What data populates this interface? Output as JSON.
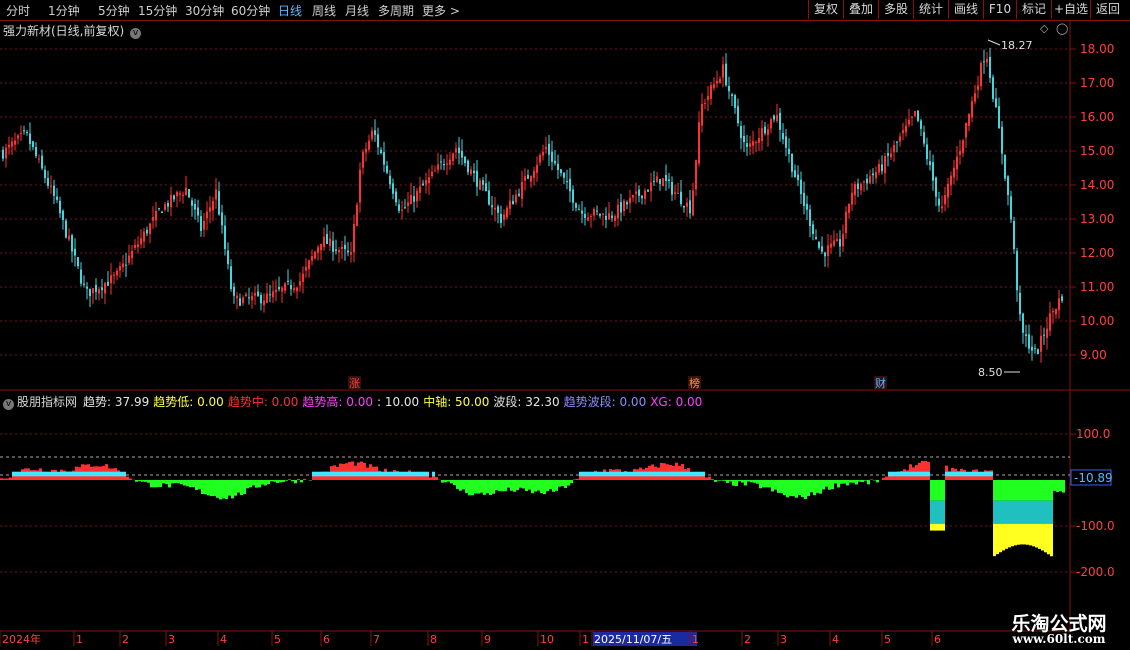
{
  "toolbar": {
    "periods": [
      "分时",
      "1分钟",
      "5分钟",
      "15分钟",
      "30分钟",
      "60分钟",
      "日线",
      "周线",
      "月线",
      "多周期",
      "更多"
    ],
    "active_period": "日线",
    "right_buttons": [
      "复权",
      "叠加",
      "多股",
      "统计",
      "画线",
      "F10",
      "标记",
      "+自选",
      "返回"
    ]
  },
  "price_panel": {
    "title": "强力新材(日线,前复权)",
    "high_label": "18.27",
    "low_label": "8.50",
    "y_ticks": [
      "18.00",
      "17.00",
      "16.00",
      "15.00",
      "14.00",
      "13.00",
      "12.00",
      "11.00",
      "10.00",
      "9.00"
    ],
    "events": [
      {
        "text": "涨",
        "color": "#ff4040"
      },
      {
        "text": "榜",
        "color": "#ff9a30"
      },
      {
        "text": "财",
        "color": "#5ab8ff"
      }
    ]
  },
  "indicator_panel": {
    "name": "股朋指标网",
    "fields": [
      {
        "label": "趋势: ",
        "value": "37.99",
        "color": "#e6e6e6"
      },
      {
        "label": "趋势低: ",
        "value": "0.00",
        "color": "#ffff40"
      },
      {
        "label": "趋势中: ",
        "value": "0.00",
        "color": "#ff3030"
      },
      {
        "label": "趋势高: ",
        "value": "0.00",
        "color": "#ff40ff"
      },
      {
        "label": ": ",
        "value": "10.00",
        "color": "#e6e6e6"
      },
      {
        "label": "中轴: ",
        "value": "50.00",
        "color": "#ffff40"
      },
      {
        "label": "波段: ",
        "value": "32.30",
        "color": "#e6e6e6"
      },
      {
        "label": "趋势波段: ",
        "value": "0.00",
        "color": "#8c8cff"
      },
      {
        "label": "XG: ",
        "value": "0.00",
        "color": "#ff40ff"
      }
    ],
    "y_ticks": [
      "100.0",
      "-100.0",
      "-200.0"
    ],
    "current_value": "-10.89"
  },
  "time_axis": {
    "labels": [
      "2024年",
      "1",
      "2",
      "3",
      "4",
      "5",
      "6",
      "7",
      "8",
      "9",
      "10",
      "1",
      "2025/11/07/五",
      "1",
      "2",
      "3",
      "4",
      "5",
      "6"
    ]
  },
  "watermark": {
    "title": "乐淘公式网",
    "url": "www.60lt.com"
  },
  "colors": {
    "up": "#ff3030",
    "down": "#40d8e0",
    "green": "#20ff20",
    "cyan": "#20c0c0",
    "yellow": "#ffff20",
    "frame": "#8a1010"
  }
}
